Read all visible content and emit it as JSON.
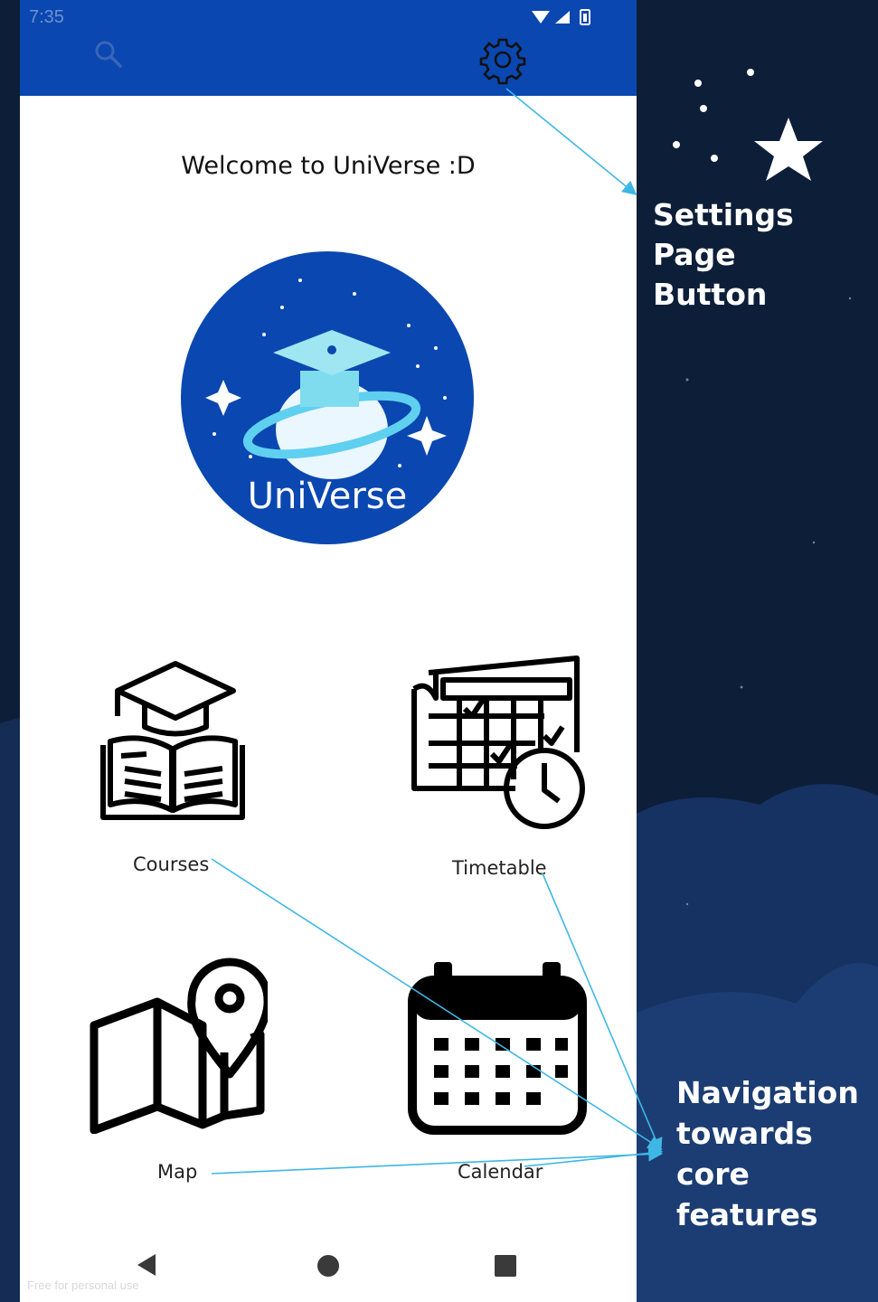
{
  "status_bar": {
    "time": "7:35"
  },
  "app_bar": {
    "search_icon": "search-icon",
    "settings_icon": "gear-icon"
  },
  "welcome_text": "Welcome to UniVerse :D",
  "logo": {
    "text": "UniVerse"
  },
  "features": [
    {
      "label": "Courses",
      "icon": "courses-book-icon"
    },
    {
      "label": "Timetable",
      "icon": "timetable-icon"
    },
    {
      "label": "Map",
      "icon": "map-icon"
    },
    {
      "label": "Calendar",
      "icon": "calendar-icon"
    }
  ],
  "bottom_nav": [
    "back-icon",
    "home-icon",
    "recents-icon"
  ],
  "watermark": "Free for personal use",
  "annotations": {
    "settings": [
      "Settings Page",
      "Button"
    ],
    "navigation": [
      "Navigation",
      "towards",
      "core",
      "features"
    ]
  },
  "colors": {
    "app_bar": "#0a47b0",
    "background": "#0d1e38",
    "arrow": "#3fb7e6"
  }
}
